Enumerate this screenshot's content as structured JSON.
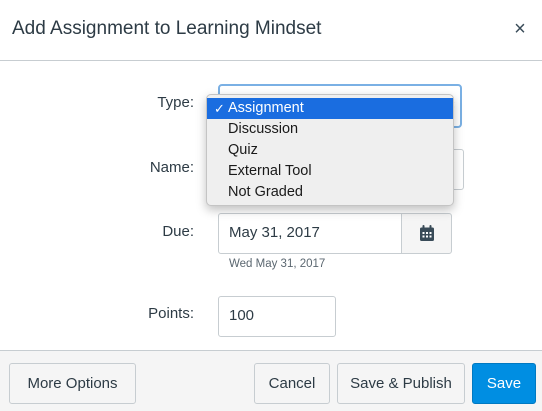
{
  "dialog": {
    "title": "Add Assignment to Learning Mindset",
    "close_symbol": "×"
  },
  "form": {
    "type": {
      "label": "Type:",
      "selected": "Assignment",
      "options": [
        "Assignment",
        "Discussion",
        "Quiz",
        "External Tool",
        "Not Graded"
      ]
    },
    "name": {
      "label": "Name:",
      "value": ""
    },
    "due": {
      "label": "Due:",
      "value": "May 31, 2017",
      "helper": "Wed May 31, 2017",
      "icon": "calendar-icon"
    },
    "points": {
      "label": "Points:",
      "value": "100"
    }
  },
  "footer": {
    "more_options": "More Options",
    "cancel": "Cancel",
    "save_publish": "Save & Publish",
    "save": "Save"
  },
  "colors": {
    "primary": "#008ee2",
    "select_highlight": "#1a6de0",
    "focus_ring": "#7ab0e4"
  }
}
